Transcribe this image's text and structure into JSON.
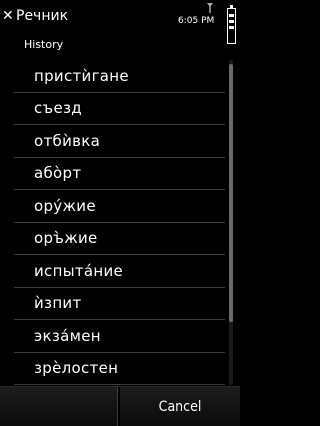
{
  "header": {
    "close_icon": "close-icon",
    "title": "Речник",
    "time": "6:05 PM",
    "section_label": "History"
  },
  "history": {
    "items": [
      "пристѝгане",
      "съезд",
      "отбѝвка",
      "або̀рт",
      "ору́жие",
      "оръ̀жие",
      "испыта́ние",
      "ѝзпит",
      "экза́мен",
      "зрѐлостен"
    ]
  },
  "softkeys": {
    "left": "",
    "right": "Cancel"
  },
  "scrollbar": {
    "position_fraction": 0.0,
    "visible_fraction": 0.8
  }
}
